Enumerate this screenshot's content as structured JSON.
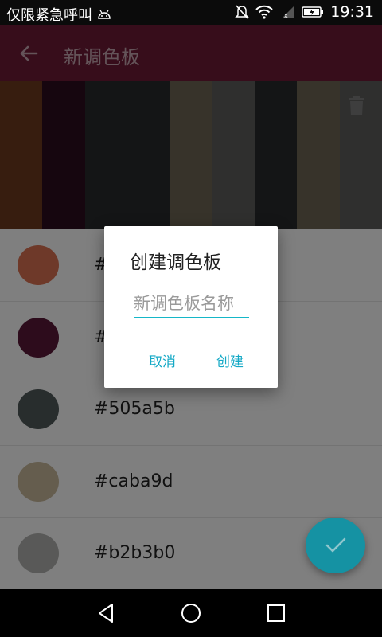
{
  "status_bar": {
    "carrier": "仅限紧急呼叫",
    "time": "19:31"
  },
  "app_bar": {
    "title": "新调色板",
    "color": "#6e1a36"
  },
  "palette": {
    "swatches": [
      "#6e3a1e",
      "#2c0d1f",
      "#282b2d",
      "#282b2d",
      "#6e6755",
      "#5f5f5d",
      "#282b2d",
      "#6e6755",
      "#5f5f5d"
    ]
  },
  "colors": [
    {
      "hex": "#",
      "color": "#dd7353"
    },
    {
      "hex": "#",
      "color": "#5a1938"
    },
    {
      "hex": "#505a5b",
      "color": "#505a5b"
    },
    {
      "hex": "#caba9d",
      "color": "#caba9d"
    },
    {
      "hex": "#b2b3b0",
      "color": "#b2b3b0"
    }
  ],
  "dialog": {
    "title": "创建调色板",
    "input_placeholder": "新调色板名称",
    "input_value": "",
    "cancel_label": "取消",
    "create_label": "创建"
  },
  "icons": {
    "back": "arrow-back-icon",
    "trash": "trash-icon",
    "fab": "check-icon"
  },
  "accent_color": "#15b7c8"
}
